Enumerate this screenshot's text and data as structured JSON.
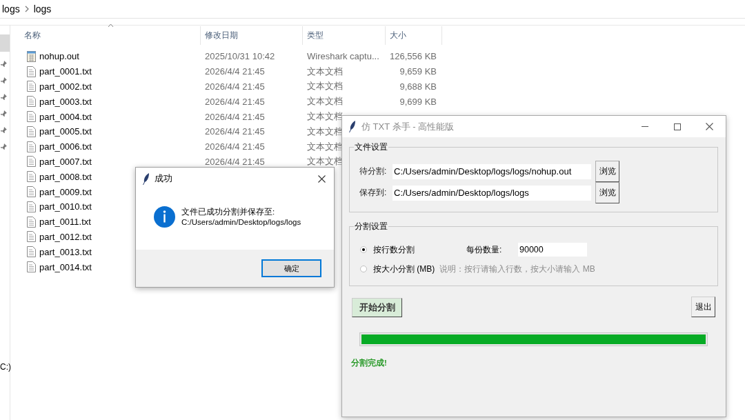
{
  "explorer": {
    "breadcrumb": [
      "logs",
      "logs"
    ],
    "nav_drive_label": "C:)",
    "columns": [
      {
        "label": "名称",
        "sorted": true
      },
      {
        "label": "修改日期",
        "sorted": false
      },
      {
        "label": "类型",
        "sorted": false
      },
      {
        "label": "大小",
        "sorted": false
      }
    ],
    "rows": [
      {
        "kind": "capture",
        "name": "nohup.out",
        "date": "2025/10/31 10:42",
        "type": "Wireshark captu...",
        "size": "126,556 KB"
      },
      {
        "kind": "text",
        "name": "part_0001.txt",
        "date": "2026/4/4 21:45",
        "type": "文本文档",
        "size": "9,659 KB"
      },
      {
        "kind": "text",
        "name": "part_0002.txt",
        "date": "2026/4/4 21:45",
        "type": "文本文档",
        "size": "9,688 KB"
      },
      {
        "kind": "text",
        "name": "part_0003.txt",
        "date": "2026/4/4 21:45",
        "type": "文本文档",
        "size": "9,699 KB"
      },
      {
        "kind": "text",
        "name": "part_0004.txt",
        "date": "2026/4/4 21:45",
        "type": "文本文档"
      },
      {
        "kind": "text",
        "name": "part_0005.txt",
        "date": "2026/4/4 21:45",
        "type": "文本文档"
      },
      {
        "kind": "text",
        "name": "part_0006.txt",
        "date": "2026/4/4 21:45",
        "type": "文本文档"
      },
      {
        "kind": "text",
        "name": "part_0007.txt",
        "date": "2026/4/4 21:45",
        "type": "文本文档"
      },
      {
        "kind": "text",
        "name": "part_0008.txt"
      },
      {
        "kind": "text",
        "name": "part_0009.txt"
      },
      {
        "kind": "text",
        "name": "part_0010.txt"
      },
      {
        "kind": "text",
        "name": "part_0011.txt"
      },
      {
        "kind": "text",
        "name": "part_0012.txt"
      },
      {
        "kind": "text",
        "name": "part_0013.txt"
      },
      {
        "kind": "text",
        "name": "part_0014.txt"
      }
    ]
  },
  "dialog": {
    "title": "成功",
    "message_lines": [
      "文件已成功分割并保存至:",
      "C:/Users/admin/Desktop/logs/logs"
    ],
    "button": "确定"
  },
  "app": {
    "title": "仿 TXT 杀手 - 高性能版",
    "file_group": {
      "title": "文件设置",
      "rows": [
        {
          "label": "待分割:",
          "value": "C:/Users/admin/Desktop/logs/logs/nohup.out",
          "button": "浏览"
        },
        {
          "label": "保存到:",
          "value": "C:/Users/admin/Desktop/logs/logs",
          "button": "浏览"
        }
      ]
    },
    "split_group": {
      "title": "分割设置",
      "options": [
        {
          "label": "按行数分割",
          "selected": true
        },
        {
          "label": "按大小分割 (MB)",
          "selected": false
        }
      ],
      "count_label": "每份数量:",
      "count_value": "90000",
      "note": "说明：按行请输入行数，按大小请输入 MB"
    },
    "start_button": "开始分割",
    "exit_button": "退出",
    "progress": {
      "level": 1
    },
    "status": "分割完成!"
  }
}
